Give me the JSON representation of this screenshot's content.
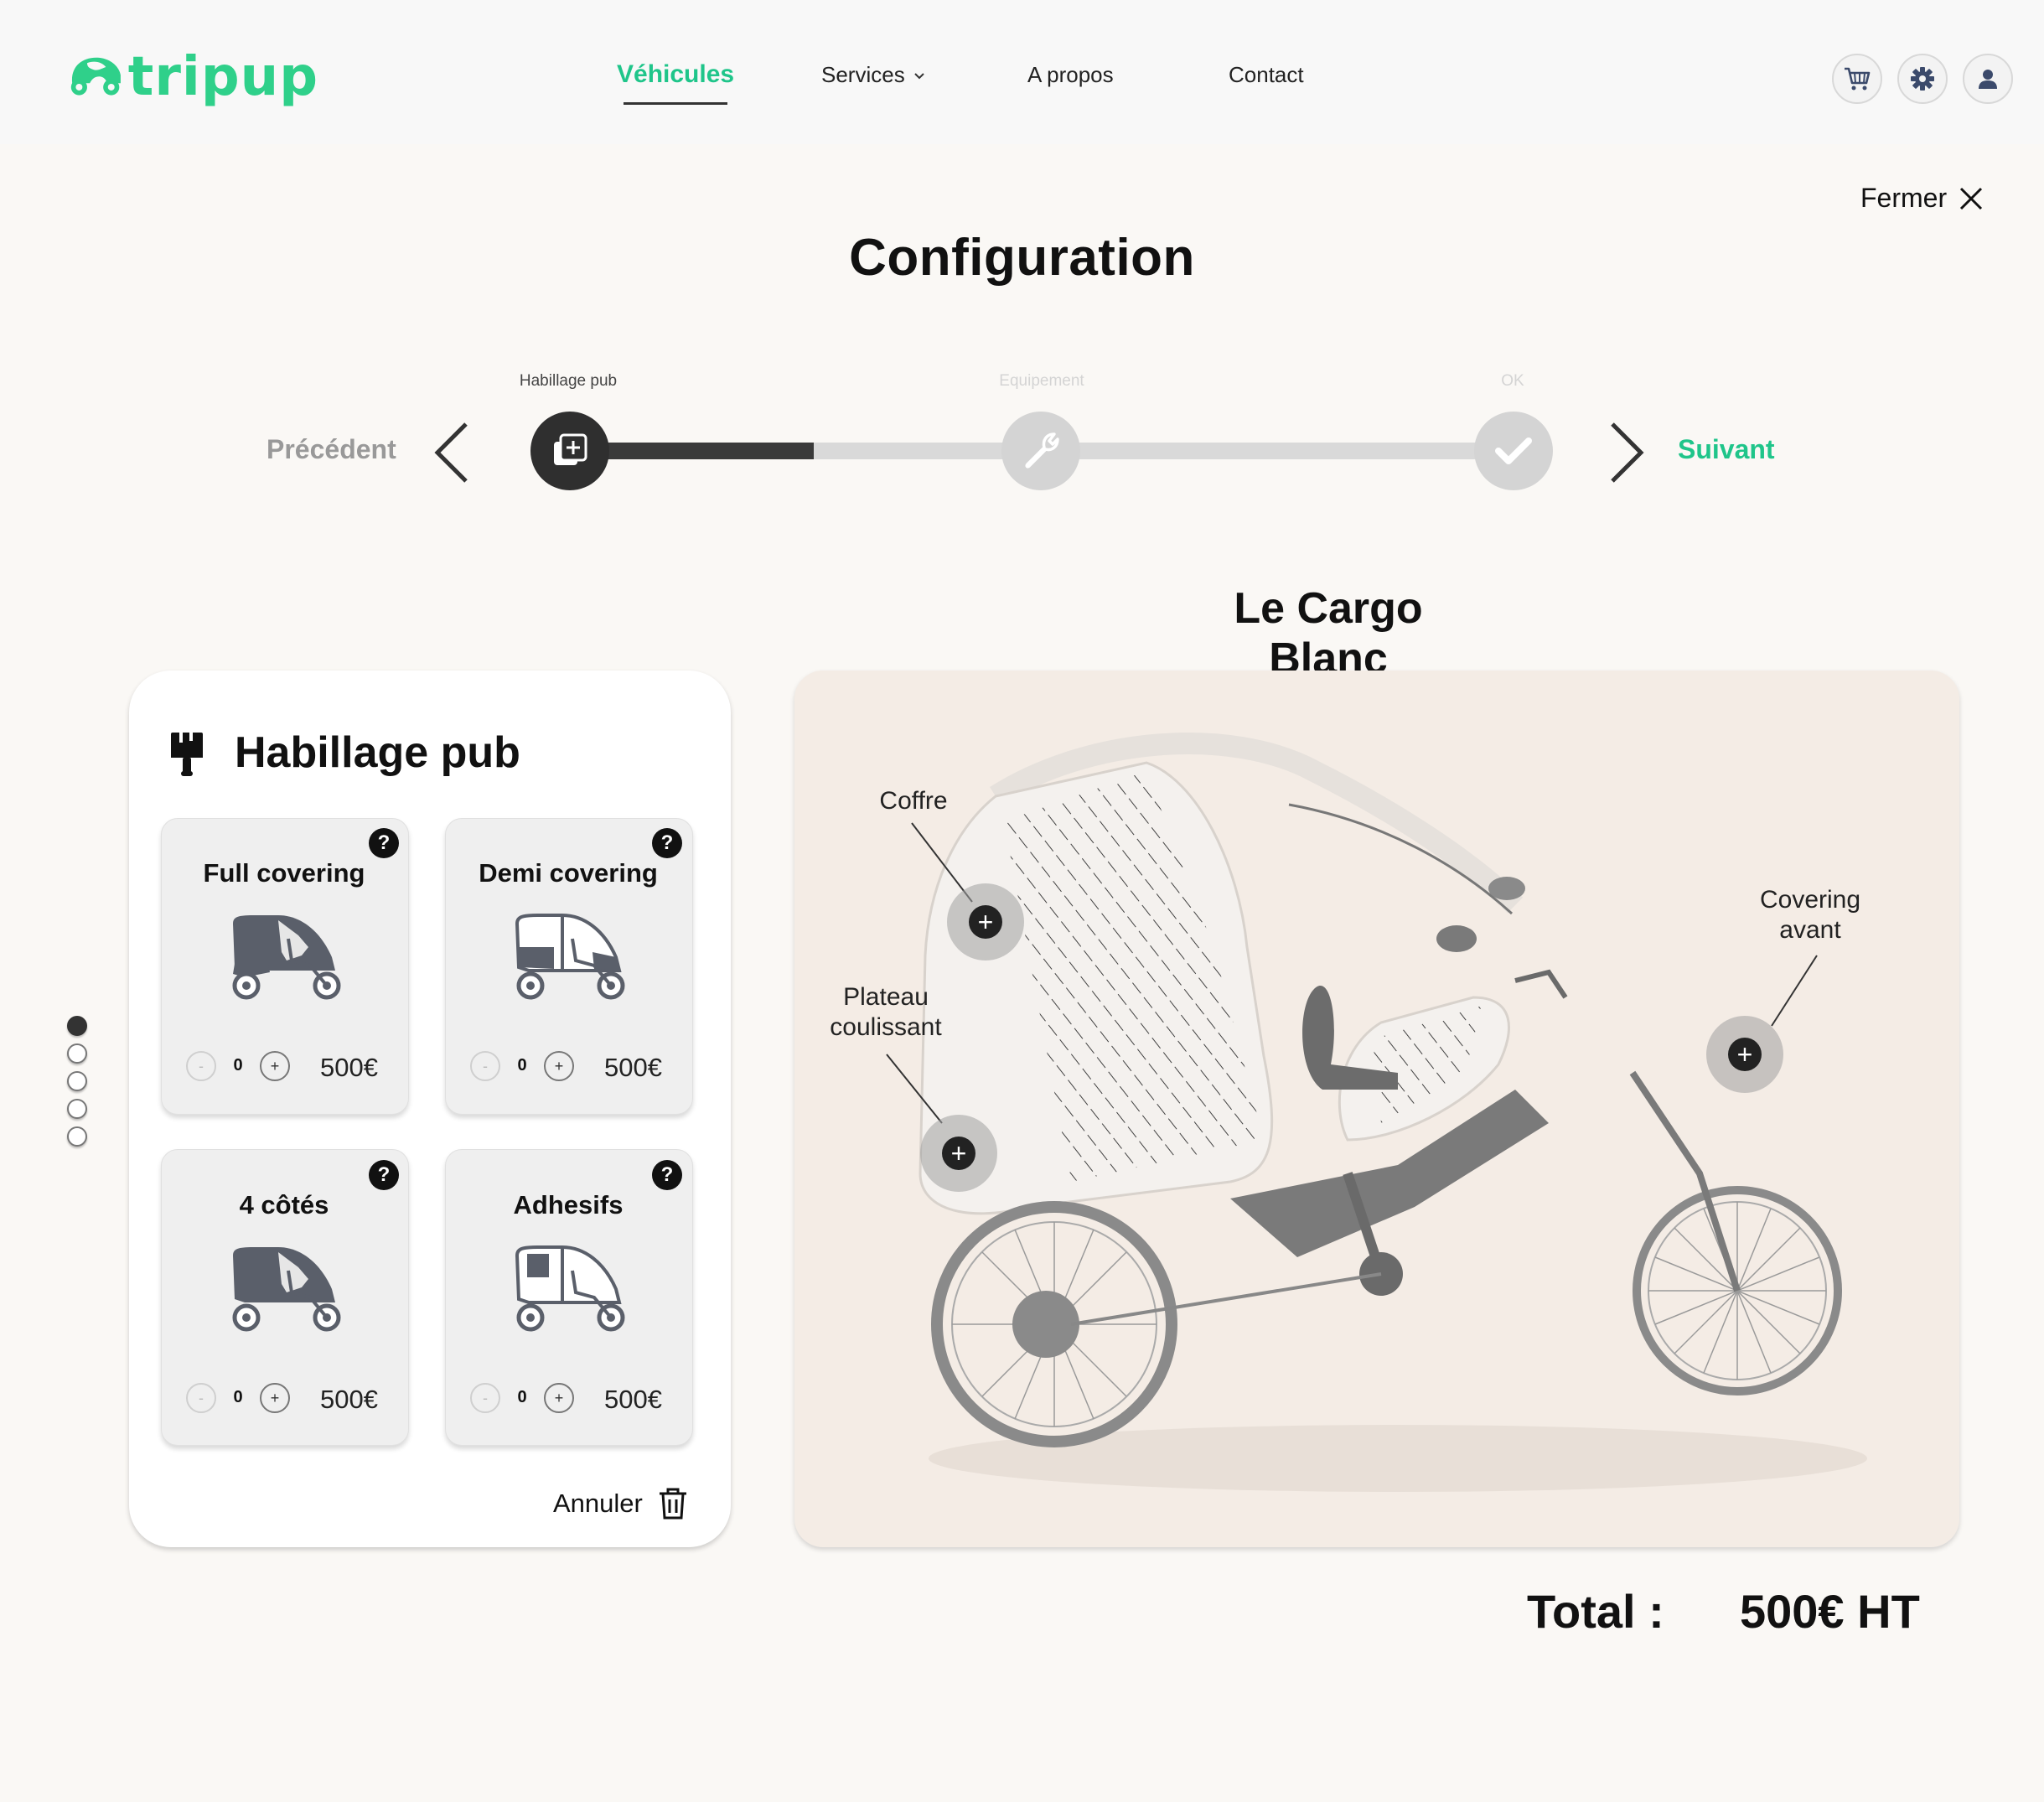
{
  "brand": {
    "name": "tripup",
    "color": "#2fd08a"
  },
  "nav": {
    "items": [
      {
        "label": "Véhicules",
        "active": true
      },
      {
        "label": "Services",
        "has_dropdown": true
      },
      {
        "label": "A propos"
      },
      {
        "label": "Contact"
      }
    ],
    "icons": [
      "cart-icon",
      "gear-icon",
      "user-icon"
    ]
  },
  "close_label": "Fermer",
  "page_title": "Configuration",
  "stepper": {
    "prev_label": "Précédent",
    "next_label": "Suivant",
    "steps": [
      {
        "label": "Habillage pub",
        "icon": "add-layer-icon",
        "state": "active"
      },
      {
        "label": "Equipement",
        "icon": "wrench-icon",
        "state": "pending"
      },
      {
        "label": "OK",
        "icon": "check-icon",
        "state": "pending"
      }
    ],
    "progress_fraction": 0.24
  },
  "product_title": "Le Cargo Blanc",
  "panel": {
    "title": "Habillage pub",
    "icon": "paint-brush-icon",
    "cards": [
      {
        "title": "Full covering",
        "qty": "0",
        "price": "500€",
        "help": "?"
      },
      {
        "title": "Demi covering",
        "qty": "0",
        "price": "500€",
        "help": "?"
      },
      {
        "title": "4 côtés",
        "qty": "0",
        "price": "500€",
        "help": "?"
      },
      {
        "title": "Adhesifs",
        "qty": "0",
        "price": "500€",
        "help": "?"
      }
    ],
    "minus_label": "-",
    "plus_label": "+",
    "cancel_label": "Annuler"
  },
  "pagination": {
    "count": 5,
    "active_index": 0
  },
  "viewer": {
    "callouts": [
      {
        "label": "Coffre"
      },
      {
        "label": "Plateau coulissant"
      },
      {
        "label": "Covering avant"
      }
    ],
    "hotspot_symbol": "+"
  },
  "total": {
    "label": "Total :",
    "value": "500€ HT"
  }
}
